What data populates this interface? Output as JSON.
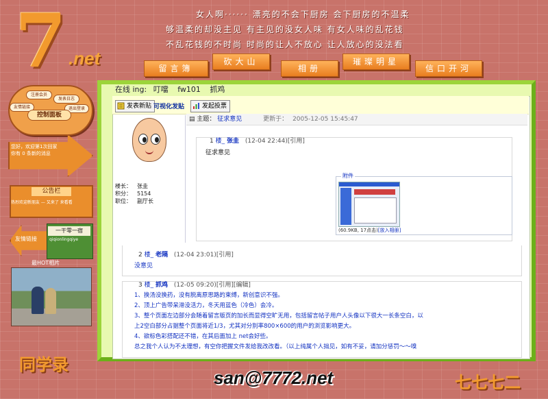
{
  "header": {
    "logo_main": "7",
    "logo_suffix": ".net",
    "slogans": [
      "女人啊······  漂亮的不会下厨房  会下厨房的不温柔",
      "够温柔的却没主见  有主见的没女人味  有女人味的乱花钱",
      "不乱花钱的不时尚  时尚的让人不放心  让人放心的没法看"
    ],
    "nav": [
      "留言簿",
      "砍大山",
      "相册",
      "璀璨明星",
      "信口开河"
    ]
  },
  "sidebar": {
    "control_buttons": [
      "注册会员",
      "发表日志",
      "友情链接",
      "退出登录"
    ],
    "control_title": "控制面板",
    "welcome_line1": "您好，欢迎第1次回家",
    "welcome_line2": "你有 0 条新的消息",
    "notice_title": "公告栏",
    "notice_text": "热烈欢迎新朋友 — 又来了 来看看",
    "friend_label": "友情链接",
    "banner_text": "一干零一宿",
    "banner_sub": "qiqionlingqiye",
    "hot_label": "最HOT相片"
  },
  "main": {
    "online_label": "在线 ing:",
    "online_users": [
      "叮噹",
      "fw101",
      "抓鸡"
    ],
    "toolbar": {
      "new_post": "发表新贴",
      "visual_post": "可视化发贴",
      "new_poll": "发起投票"
    },
    "topic": {
      "label": "主题：",
      "title": "征求意见",
      "updated_label": "更新于：",
      "updated": "2005-12-05 15:45:47"
    },
    "author": {
      "role_label": "楼长：",
      "name": "张圭",
      "points_label": "积分：",
      "points": "5154",
      "title_label": "职位：",
      "title": "副厅长"
    },
    "posts": [
      {
        "num": "1",
        "floor": "楼_",
        "name": "张圭",
        "time": "(12-04 22:44)",
        "actions": "[引用]",
        "body": "征求意见"
      },
      {
        "num": "2",
        "floor": "楼_",
        "name": "老隔",
        "time": "(12-04 23:01)",
        "actions": "[引用]",
        "body": "没意见"
      },
      {
        "num": "3",
        "floor": "楼_",
        "name": "抓鸡",
        "time": "(12-05 09:20)",
        "actions": "[引用][编辑]",
        "lines": [
          "1、换汤没换药，没有脱离原思路的束缚，新创意识不强。",
          "2、顶上广告带呆滞没活力，冬天用蓝色（冷色）会冷。",
          "3、整个页面左边部分会随着留言版页的加长而显得空旷无用，包括留言帖子用户人头像以下很大一长条空白，以",
          "上2空白部分占据整个页面将近1/3，尤其对分别率800×600的用户的浏览影响更大。",
          "4、欲标色彩搭配还不错，在其后面加上 net会好些。",
          "总之我个人认为不太理想，有空你把握文件发给我改改看。（以上纯属个人拙见，如有不妥，请加分惩罚～～嗅"
        ]
      }
    ],
    "attachment": {
      "label": "附件",
      "meta": "(60.9KB, 17点击)",
      "action": "[放入相册]"
    }
  },
  "footer": {
    "email": "san@7772.net",
    "logo_left": "同学录",
    "logo_right": "七七七二"
  }
}
